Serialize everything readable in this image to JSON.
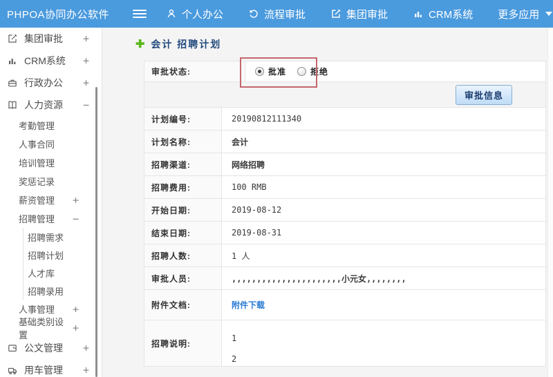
{
  "navbar": {
    "brand": "PHPOA协同办公软件",
    "items": [
      {
        "label": "个人办公",
        "icon": "person-icon"
      },
      {
        "label": "流程审批",
        "icon": "history-icon"
      },
      {
        "label": "集团审批",
        "icon": "edit-icon"
      },
      {
        "label": "CRM系统",
        "icon": "bar-chart-icon"
      },
      {
        "label": "更多应用",
        "icon": "caret-down-icon"
      }
    ]
  },
  "sidebar": {
    "items": [
      {
        "label": "集团审批",
        "toggle": "+",
        "icon": "edit-square-icon"
      },
      {
        "label": "CRM系统",
        "toggle": "+",
        "icon": "bar-chart-icon"
      },
      {
        "label": "行政办公",
        "toggle": "+",
        "icon": "briefcase-icon"
      },
      {
        "label": "人力资源",
        "toggle": "−",
        "icon": "book-icon"
      },
      {
        "label": "考勤管理"
      },
      {
        "label": "人事合同"
      },
      {
        "label": "培训管理"
      },
      {
        "label": "奖惩记录"
      },
      {
        "label": "薪资管理",
        "toggle": "+"
      },
      {
        "label": "招聘管理",
        "toggle": "−"
      },
      {
        "label": "招聘需求"
      },
      {
        "label": "招聘计划"
      },
      {
        "label": "人才库"
      },
      {
        "label": "招聘录用"
      },
      {
        "label": "人事管理",
        "toggle": "+"
      },
      {
        "label": "基础类别设置",
        "toggle": "+"
      },
      {
        "label": "公文管理",
        "toggle": "+",
        "icon": "document-icon"
      },
      {
        "label": "用车管理",
        "toggle": "+",
        "icon": "truck-icon"
      }
    ]
  },
  "main": {
    "title": "会计 招聘计划",
    "approval": {
      "status_label": "审批状态:",
      "options": [
        {
          "label": "批准",
          "selected": true
        },
        {
          "label": "拒绝",
          "selected": false
        }
      ],
      "button_label": "审批信息"
    },
    "fields": [
      {
        "label": "计划编号:",
        "value": "20190812111340"
      },
      {
        "label": "计划名称:",
        "value": "会计"
      },
      {
        "label": "招聘渠道:",
        "value": "网络招聘"
      },
      {
        "label": "招聘费用:",
        "value": "100 RMB"
      },
      {
        "label": "开始日期:",
        "value": "2019-08-12"
      },
      {
        "label": "结束日期:",
        "value": "2019-08-31"
      },
      {
        "label": "招聘人数:",
        "value": "1 人"
      },
      {
        "label": "审批人员:",
        "value": ",,,,,,,,,,,,,,,,,,,,,,小元女,,,,,,,,"
      },
      {
        "label": "附件文档:",
        "value": "附件下载"
      },
      {
        "label": "招聘说明:",
        "lines": [
          "1",
          "2"
        ]
      }
    ]
  },
  "colors": {
    "navbar_bg": "#4a9ade",
    "title_text": "#234a7d",
    "plus_green": "#5cb81f",
    "link_blue": "#2b7cd5",
    "highlight_red": "#c4666c",
    "button_border": "#85aed3",
    "button_text": "#1b3c6e",
    "row_border": "#e5e5e5"
  }
}
